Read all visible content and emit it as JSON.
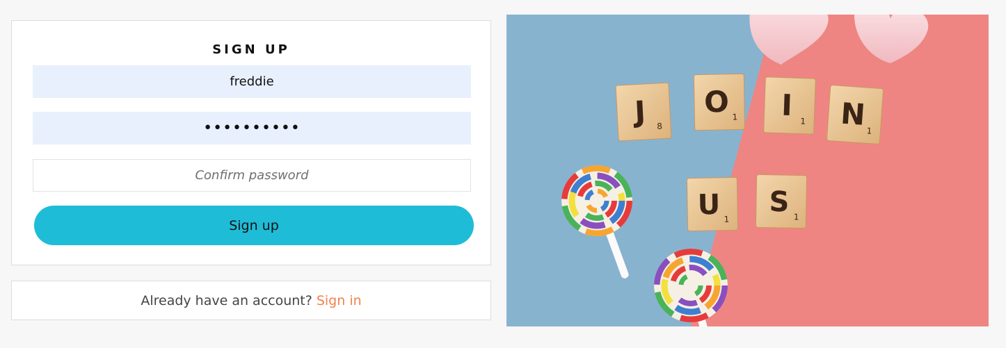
{
  "form": {
    "title": "SIGN UP",
    "username_value": "freddie",
    "password_value": "••••••••••",
    "confirm_placeholder": "Confirm password",
    "submit_label": "Sign up"
  },
  "footer": {
    "prompt": "Already have an account?",
    "link_label": "Sign in"
  },
  "image": {
    "tiles_row1": [
      "J",
      "O",
      "I",
      "N"
    ],
    "tiles_row1_points": [
      "8",
      "1",
      "1",
      "1"
    ],
    "tiles_row2": [
      "U",
      "S"
    ],
    "tiles_row2_points": [
      "1",
      "1"
    ]
  },
  "colors": {
    "accent_button": "#1fbcd7",
    "link": "#f0824d",
    "input_filled": "#e8f0fd",
    "photo_blue": "#88b3cf",
    "photo_pink": "#ee8583"
  }
}
